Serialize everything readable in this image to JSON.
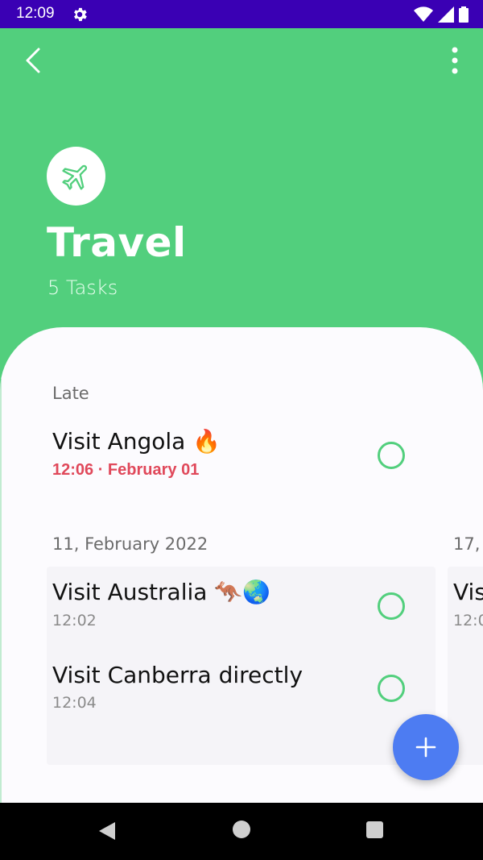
{
  "status_bar": {
    "time": "12:09"
  },
  "header": {
    "category_title": "Travel",
    "task_count": "5 Tasks",
    "category_icon": "airplane-icon",
    "accent_color": "#52cf7d"
  },
  "sections": {
    "late": {
      "label": "Late",
      "tasks": [
        {
          "title": "Visit Angola 🔥",
          "subtitle": "12:06 · February 01"
        }
      ]
    },
    "feb11": {
      "label": "11, February 2022",
      "tasks": [
        {
          "title": "Visit Australia 🦘🌏",
          "subtitle": "12:02"
        },
        {
          "title": "Visit Canberra directly",
          "subtitle": "12:04"
        }
      ]
    },
    "feb17": {
      "label": "17,",
      "tasks": [
        {
          "title": "Vis",
          "subtitle": "12:0"
        }
      ]
    }
  },
  "fab": {
    "icon": "plus-icon",
    "color": "#4d7cf2"
  }
}
